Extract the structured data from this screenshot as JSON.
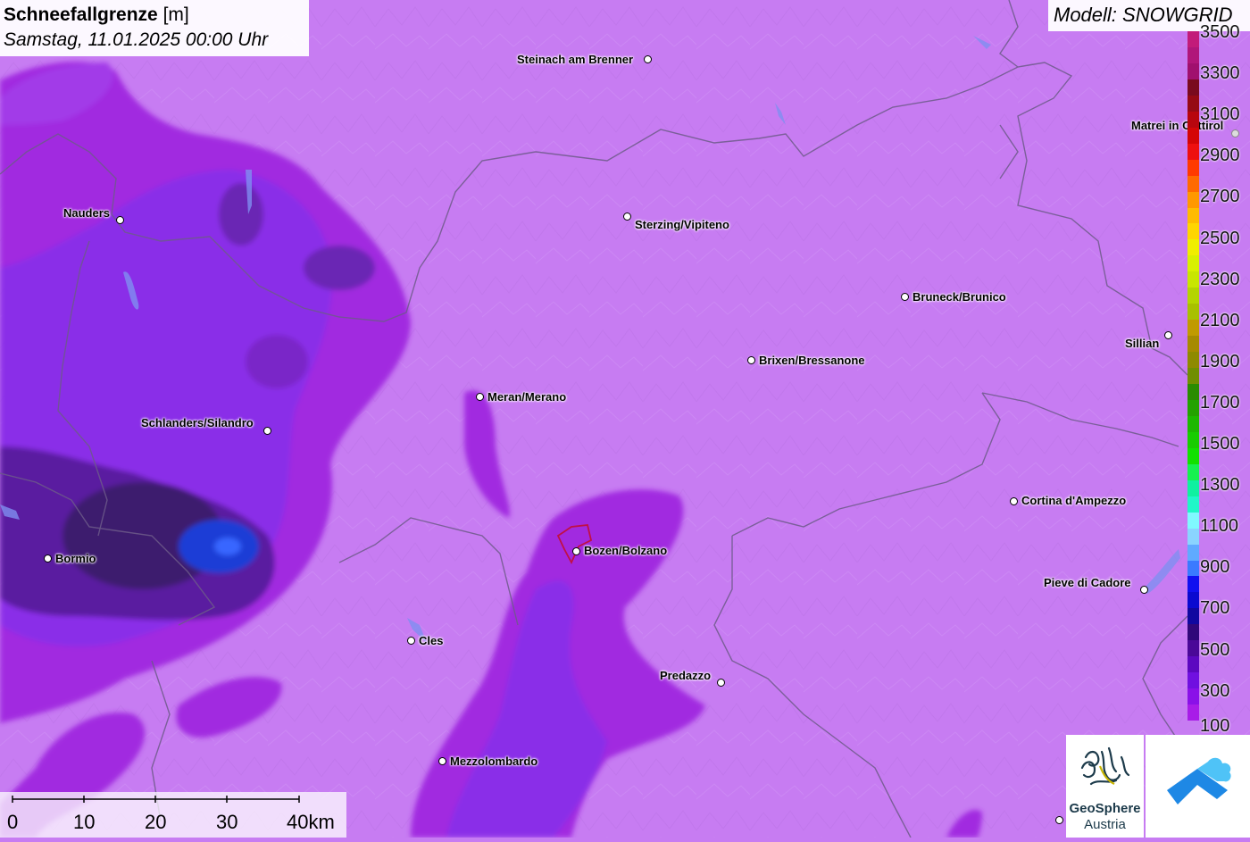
{
  "title": {
    "parameter": "Schneefallgrenze",
    "unit": "[m]",
    "datetime": "Samstag, 11.01.2025 00:00 Uhr"
  },
  "model": "Modell: SNOWGRID",
  "cities": [
    {
      "name": "Steinach am Brenner"
    },
    {
      "name": "Matrei in Osttirol"
    },
    {
      "name": "Nauders"
    },
    {
      "name": "Sterzing/Vipiteno"
    },
    {
      "name": "Bruneck/Brunico"
    },
    {
      "name": "Sillian"
    },
    {
      "name": "Brixen/Bressanone"
    },
    {
      "name": "Meran/Merano"
    },
    {
      "name": "Schlanders/Silandro"
    },
    {
      "name": "Cortina d'Ampezzo"
    },
    {
      "name": "Bozen/Bolzano"
    },
    {
      "name": "Bormio"
    },
    {
      "name": "Pieve di Cadore"
    },
    {
      "name": "Cles"
    },
    {
      "name": "Predazzo"
    },
    {
      "name": "Mezzolombardo"
    }
  ],
  "legend": {
    "labels": [
      "3500",
      "3300",
      "3100",
      "2900",
      "2700",
      "2500",
      "2300",
      "2100",
      "1900",
      "1700",
      "1500",
      "1300",
      "1100",
      "900",
      "700",
      "500",
      "300",
      "100"
    ],
    "colors": [
      "#c21b7a",
      "#b0167a",
      "#a0106e",
      "#7a0a1e",
      "#960a14",
      "#b8060e",
      "#d40606",
      "#ee1010",
      "#ff3a00",
      "#ff6a00",
      "#ff9800",
      "#ffbb00",
      "#ffd500",
      "#f0ee00",
      "#d8f000",
      "#c8e600",
      "#b4d400",
      "#a8c000",
      "#c09a00",
      "#a68a00",
      "#8e8a00",
      "#708e00",
      "#2a8c00",
      "#23a200",
      "#1db800",
      "#18cc00",
      "#12e000",
      "#16f050",
      "#10f0a0",
      "#20f6c8",
      "#80f8ff",
      "#8ad4ff",
      "#60aaff",
      "#3a7aff",
      "#1010f0",
      "#0a0ad0",
      "#1008a0",
      "#30087a",
      "#4a0898",
      "#5c08c0",
      "#7010e0",
      "#8a10e8",
      "#a81ce8",
      "#c77cf2"
    ]
  },
  "scalebar": {
    "labels": [
      "0",
      "10",
      "20",
      "30",
      "40km"
    ]
  },
  "logo": {
    "line1": "GeoSphere",
    "line2": "Austria"
  }
}
